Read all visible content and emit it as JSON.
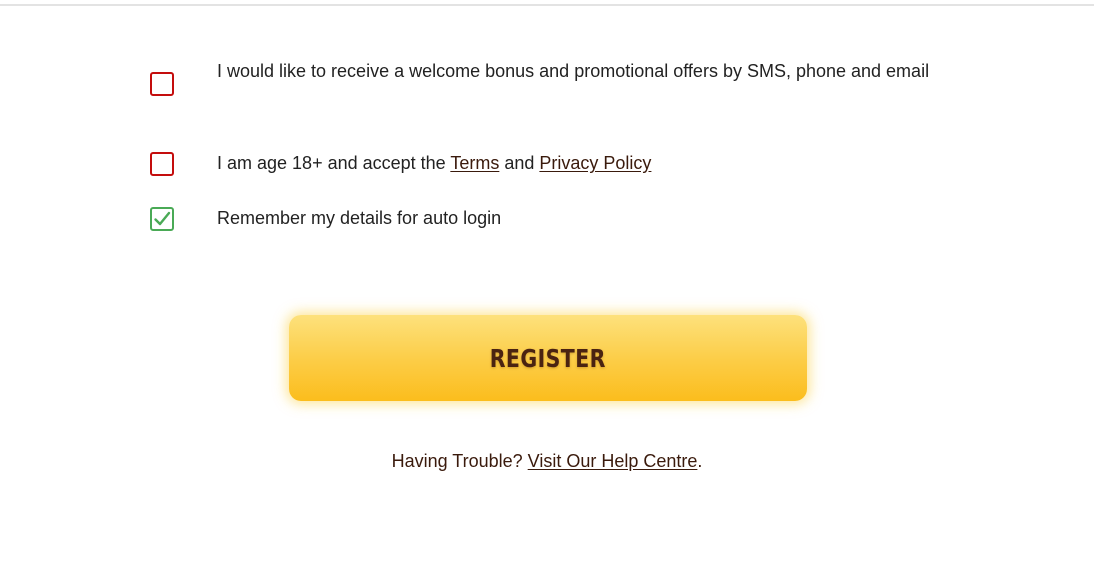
{
  "consents": {
    "promo": {
      "label": "I would like to receive a welcome bonus and promotional offers by SMS, phone and email",
      "checked": false
    },
    "age_terms": {
      "prefix": "I am age 18+ and accept the ",
      "terms_link": "Terms",
      "middle": " and ",
      "privacy_link": "Privacy Policy",
      "checked": false
    },
    "remember": {
      "label": "Remember my details for auto login",
      "checked": true
    }
  },
  "register": {
    "label": "REGISTER"
  },
  "help": {
    "prefix": "Having Trouble? ",
    "link": "Visit Our Help Centre",
    "suffix": "."
  },
  "colors": {
    "unchecked_border": "#c40d0d",
    "checked_border": "#4aaa56",
    "button_top": "#fde17c",
    "button_bottom": "#fbbd1d",
    "button_text": "#4a2311",
    "link_text": "#3a1a0c"
  }
}
